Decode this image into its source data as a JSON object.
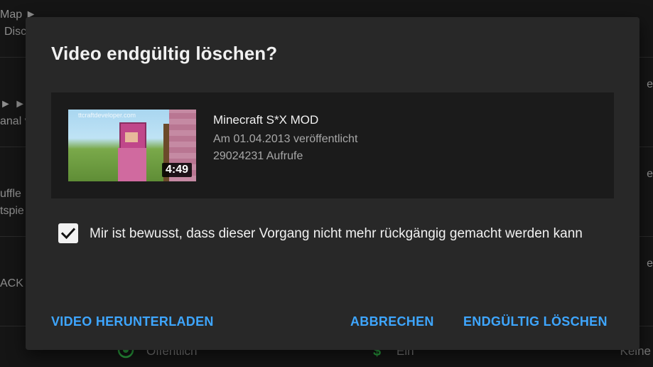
{
  "background": {
    "left_column": [
      "Map ►",
      "Disc",
      "► ►",
      "anal v",
      "uffle",
      "tspie",
      "ACK M"
    ],
    "right_column": [
      "e",
      "e",
      "e",
      "e"
    ],
    "bottom_row": {
      "visibility": "Öffentlich",
      "monetization": "Ein",
      "restrictions": "Keine"
    },
    "icons": [
      "globe-icon",
      "dollar-icon"
    ],
    "icon_colors": {
      "globe": "#2ba640",
      "dollar": "#2ba640"
    }
  },
  "dialog": {
    "title": "Video endgültig löschen?",
    "video": {
      "title": "Minecraft S*X MOD",
      "published": "Am 01.04.2013 veröffentlicht",
      "views": "29024231 Aufrufe",
      "duration": "4:49",
      "thumbnail_caption": "ttcraftdeveloper.com"
    },
    "confirm": {
      "checked": true,
      "text": "Mir ist bewusst, dass dieser Vorgang nicht mehr rückgängig gemacht werden kann"
    },
    "actions": {
      "download": "VIDEO HERUNTERLADEN",
      "cancel": "ABBRECHEN",
      "delete": "ENDGÜLTIG LÖSCHEN"
    }
  },
  "colors": {
    "accent": "#3ea6ff",
    "dialog_bg": "#282828",
    "card_bg": "#1b1b1b",
    "page_bg": "#151515"
  }
}
